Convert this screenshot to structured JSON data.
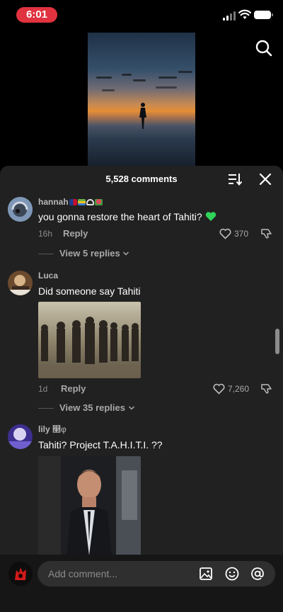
{
  "status_bar": {
    "time": "6:01"
  },
  "sheet": {
    "title": "5,528 comments"
  },
  "comments": [
    {
      "username": "hannah",
      "username_emojis": [
        "flag-emoji",
        "books-emoji",
        "headphones-emoji",
        "rose-emoji"
      ],
      "text": "you gonna restore the heart of Tahiti?",
      "text_emoji": "green-heart-emoji",
      "age": "16h",
      "reply_label": "Reply",
      "likes": "370",
      "view_replies": "View 5 replies"
    },
    {
      "username": "Luca",
      "text": "Did someone say Tahiti",
      "age": "1d",
      "reply_label": "Reply",
      "likes": "7,260",
      "view_replies": "View 35 replies"
    },
    {
      "username": "lily",
      "username_suffix": "௢φ",
      "text": "Tahiti? Project T.A.H.I.T.I. ??"
    }
  ],
  "composer": {
    "placeholder": "Add comment..."
  },
  "colors": {
    "sheet_bg": "#212121",
    "time_pill": "#e0333f",
    "green_heart": "#2fd35a"
  },
  "icons": [
    "search-icon",
    "sort-icon",
    "close-icon",
    "heart-icon",
    "dislike-icon",
    "chevron-down-icon",
    "image-icon",
    "emoji-icon",
    "at-icon"
  ]
}
